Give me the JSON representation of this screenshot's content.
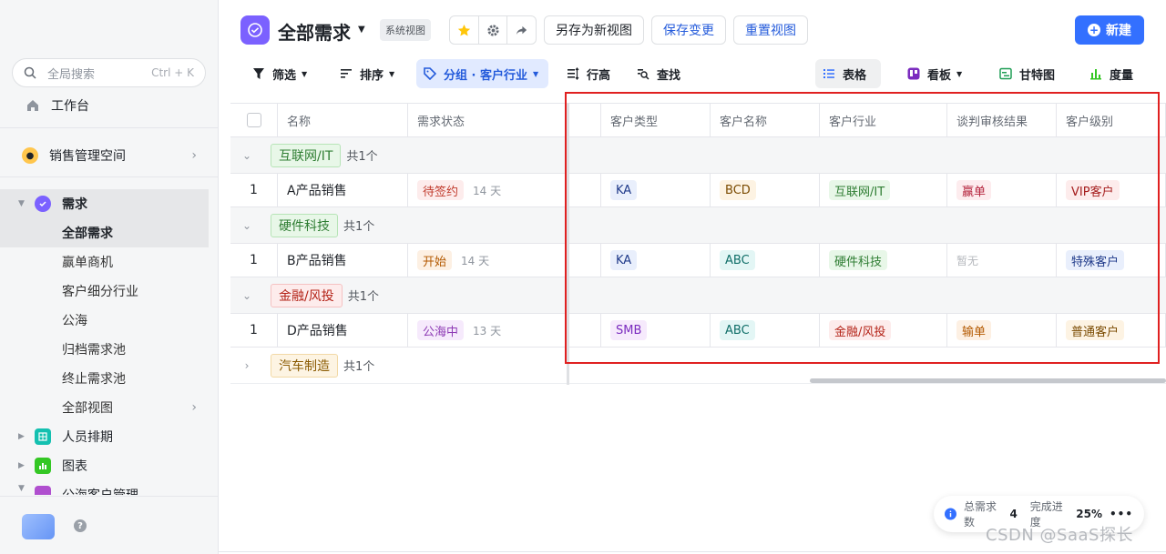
{
  "sidebar": {
    "search_placeholder": "全局搜索",
    "search_shortcut": "Ctrl + K",
    "workspace": "工作台",
    "space": "销售管理空间",
    "section": "需求",
    "views": [
      "全部需求",
      "赢单商机",
      "客户细分行业",
      "公海",
      "归档需求池",
      "终止需求池",
      "全部视图"
    ],
    "modules": [
      "人员排期",
      "图表",
      "公海客户管理"
    ]
  },
  "header": {
    "title": "全部需求",
    "badge": "系统视图",
    "save_as": "另存为新视图",
    "save_changes": "保存变更",
    "reset": "重置视图",
    "new": "新建"
  },
  "toolbar": {
    "filter": "筛选",
    "sort": "排序",
    "group": "分组 · 客户行业",
    "row_height": "行高",
    "find": "查找",
    "table": "表格",
    "kanban": "看板",
    "gantt": "甘特图",
    "metrics": "度量"
  },
  "table": {
    "columns": [
      "名称",
      "需求状态",
      "客户类型",
      "客户名称",
      "客户行业",
      "谈判审核结果",
      "客户级别"
    ],
    "groups": [
      {
        "label": "互联网/IT",
        "count": "共1个",
        "color": "#e8f7e8",
        "border": "#b7e4b7",
        "text": "#2e7d32"
      },
      {
        "label": "硬件科技",
        "count": "共1个",
        "color": "#e8f7e8",
        "border": "#b7e4b7",
        "text": "#2e7d32"
      },
      {
        "label": "金融/风投",
        "count": "共1个",
        "color": "#fdecec",
        "border": "#f5c2c2",
        "text": "#b42318"
      },
      {
        "label": "汽车制造",
        "count": "共1个",
        "color": "#fdf4e3",
        "border": "#f2d9a6",
        "text": "#8a5a00"
      }
    ],
    "rows": [
      {
        "index": "1",
        "name": "A产品销售",
        "status": "待签约",
        "days": "14 天",
        "type": "KA",
        "customer": "BCD",
        "industry": "互联网/IT",
        "result": "赢单",
        "level": "VIP客户"
      },
      {
        "index": "1",
        "name": "B产品销售",
        "status": "开始",
        "days": "14 天",
        "type": "KA",
        "customer": "ABC",
        "industry": "硬件科技",
        "result": "暂无",
        "level": "特殊客户"
      },
      {
        "index": "1",
        "name": "D产品销售",
        "status": "公海中",
        "days": "13 天",
        "type": "SMB",
        "customer": "ABC",
        "industry": "金融/风投",
        "result": "输单",
        "level": "普通客户"
      }
    ]
  },
  "stats": {
    "total_label": "总需求数",
    "total": "4",
    "progress_label": "完成进度",
    "progress": "25%"
  },
  "watermark": "CSDN @SaaS探长",
  "colors": {
    "accent": "#3370ff",
    "highlight_box": "#e02020"
  }
}
